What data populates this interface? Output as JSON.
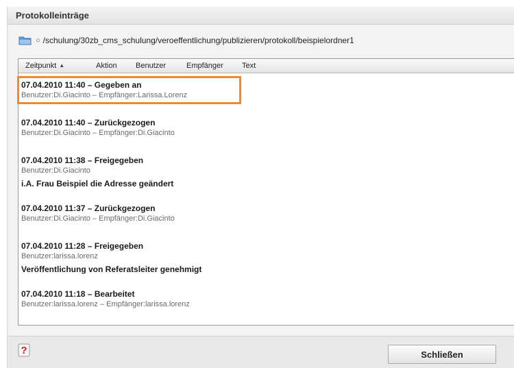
{
  "dialog": {
    "title": "Protokolleinträge",
    "path_bullet": "○",
    "path": "/schulung/30zb_cms_schulung/veroeffentlichung/publizieren/protokoll/beispielordner1"
  },
  "columns": [
    {
      "label": "Zeitpunkt",
      "sort": "ascending",
      "sort_glyph": "▲"
    },
    {
      "label": "Aktion"
    },
    {
      "label": "Benutzer"
    },
    {
      "label": "Empfänger"
    },
    {
      "label": "Text"
    }
  ],
  "entries": [
    {
      "title": "07.04.2010 11:40 – Gegeben an",
      "sub": "Benutzer:Di.Giacinto – Empfänger:Larissa.Lorenz",
      "comment": "",
      "highlighted": true
    },
    {
      "title": "07.04.2010 11:40 – Zurückgezogen",
      "sub": "Benutzer:Di.Giacinto – Empfänger:Di.Giacinto",
      "comment": ""
    },
    {
      "title": "07.04.2010 11:38 – Freigegeben",
      "sub": "Benutzer:Di.Giacinto",
      "comment": "i.A. Frau Beispiel die Adresse geändert"
    },
    {
      "title": "07.04.2010 11:37 – Zurückgezogen",
      "sub": "Benutzer:Di.Giacinto – Empfänger:Di.Giacinto",
      "comment": ""
    },
    {
      "title": "07.04.2010 11:28 – Freigegeben",
      "sub": "Benutzer:larissa.lorenz",
      "comment": "Veröffentlichung von Referatsleiter genehmigt"
    },
    {
      "title": "07.04.2010 11:18 – Bearbeitet",
      "sub": "Benutzer:larissa.lorenz – Empfänger:larissa.lorenz",
      "comment": ""
    }
  ],
  "footer": {
    "help_icon": "help-icon",
    "close_label": "Schließen"
  },
  "colors": {
    "highlight": "#f08a2c",
    "help_red": "#d0202a"
  }
}
